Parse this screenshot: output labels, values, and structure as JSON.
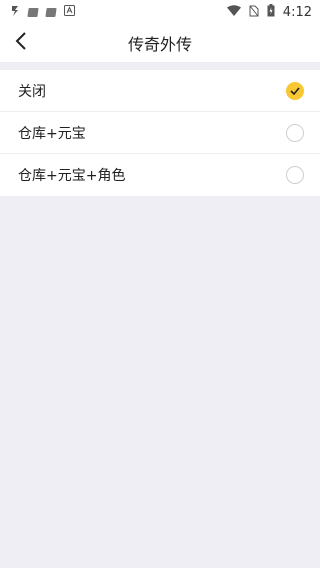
{
  "status_bar": {
    "time": "4:12",
    "left_icons": [
      "notification-s-icon",
      "app-icon",
      "app-icon",
      "app-a-icon"
    ],
    "right_icons": [
      "wifi-icon",
      "no-sim-icon",
      "battery-charging-icon"
    ]
  },
  "nav": {
    "title": "传奇外传",
    "back_icon": "chevron-left-icon"
  },
  "options": [
    {
      "label": "关闭",
      "selected": true
    },
    {
      "label": "仓库+元宝",
      "selected": false
    },
    {
      "label": "仓库+元宝+角色",
      "selected": false
    }
  ],
  "colors": {
    "accent": "#f7c832",
    "background": "#efeef4"
  }
}
